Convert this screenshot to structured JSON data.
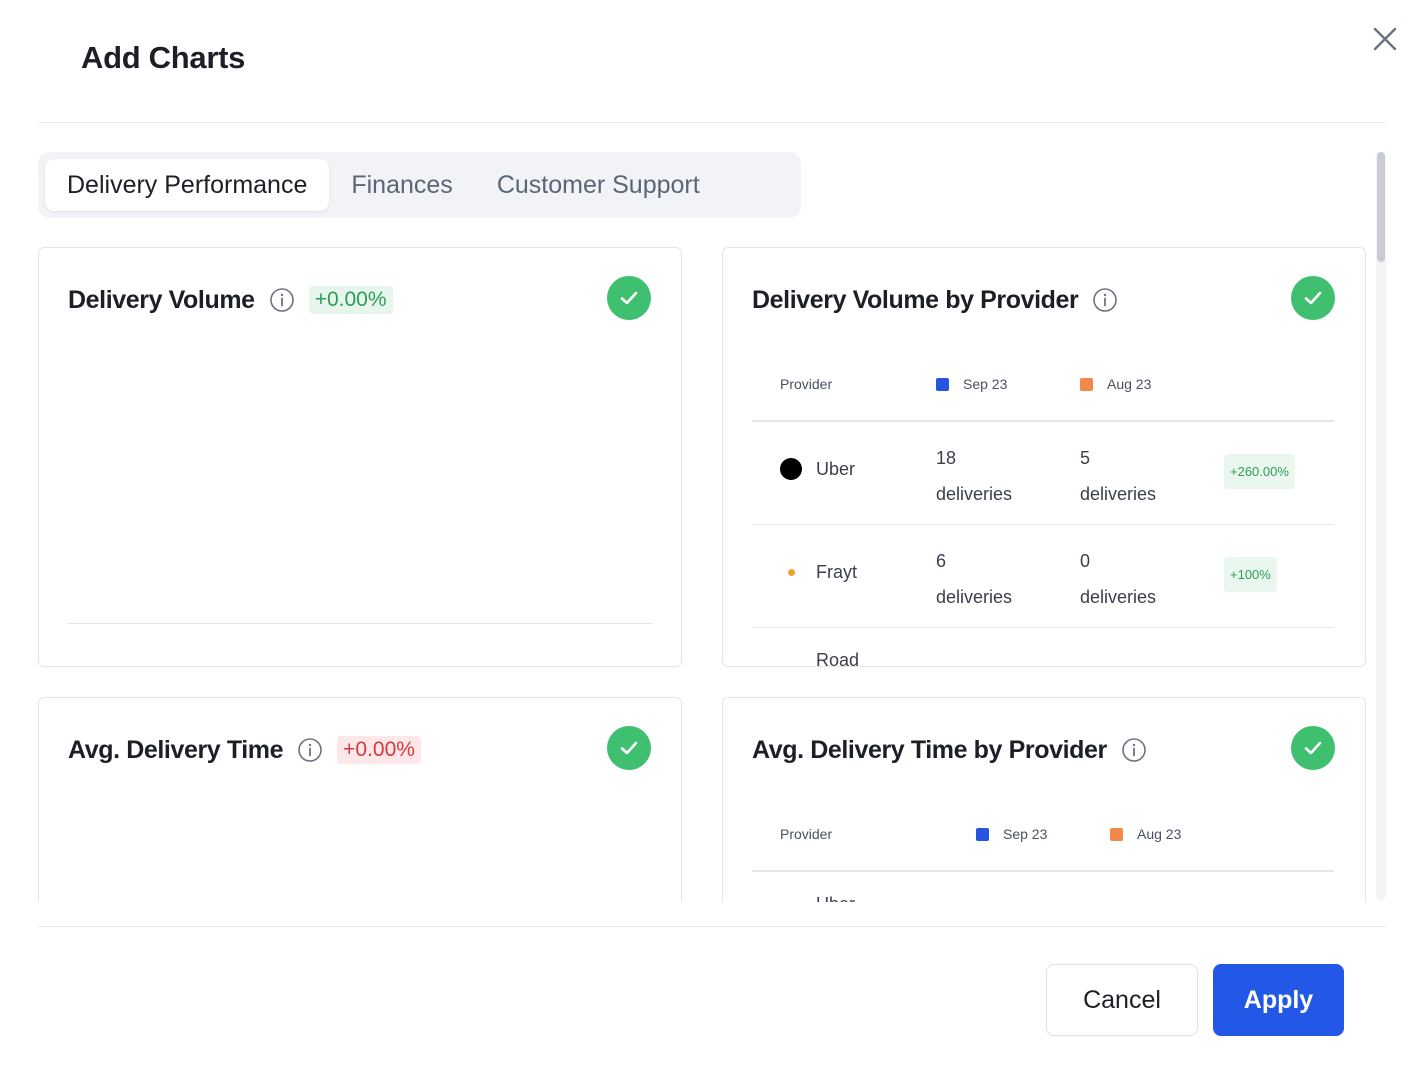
{
  "modal": {
    "title": "Add Charts"
  },
  "tabs": [
    {
      "label": "Delivery Performance",
      "active": true
    },
    {
      "label": "Finances",
      "active": false
    },
    {
      "label": "Customer Support",
      "active": false
    }
  ],
  "cards": {
    "delivery_volume": {
      "title": "Delivery Volume",
      "change": "+0.00%",
      "selected": true
    },
    "delivery_volume_by_provider": {
      "title": "Delivery Volume by Provider",
      "selected": true,
      "table": {
        "header": {
          "provider": "Provider",
          "current": "Sep 23",
          "previous": "Aug 23"
        },
        "rows": [
          {
            "provider": "Uber",
            "current_count": "18",
            "current_unit": "deliveries",
            "previous_count": "5",
            "previous_unit": "deliveries",
            "change": "+260.00%"
          },
          {
            "provider": "Frayt",
            "current_count": "6",
            "current_unit": "deliveries",
            "previous_count": "0",
            "previous_unit": "deliveries",
            "change": "+100%"
          }
        ],
        "partial_row_label": "Road"
      }
    },
    "avg_delivery_time": {
      "title": "Avg. Delivery Time",
      "change": "+0.00%",
      "selected": true
    },
    "avg_delivery_time_by_provider": {
      "title": "Avg. Delivery Time by Provider",
      "selected": true,
      "table": {
        "header": {
          "provider": "Provider",
          "current": "Sep 23",
          "previous": "Aug 23"
        },
        "partial_row_label": "Uber"
      }
    }
  },
  "colors": {
    "current_series": "#2554e0",
    "previous_series": "#f0894a",
    "check_green": "#3fbf70",
    "primary": "#2258e5"
  },
  "footer": {
    "cancel_label": "Cancel",
    "apply_label": "Apply"
  }
}
